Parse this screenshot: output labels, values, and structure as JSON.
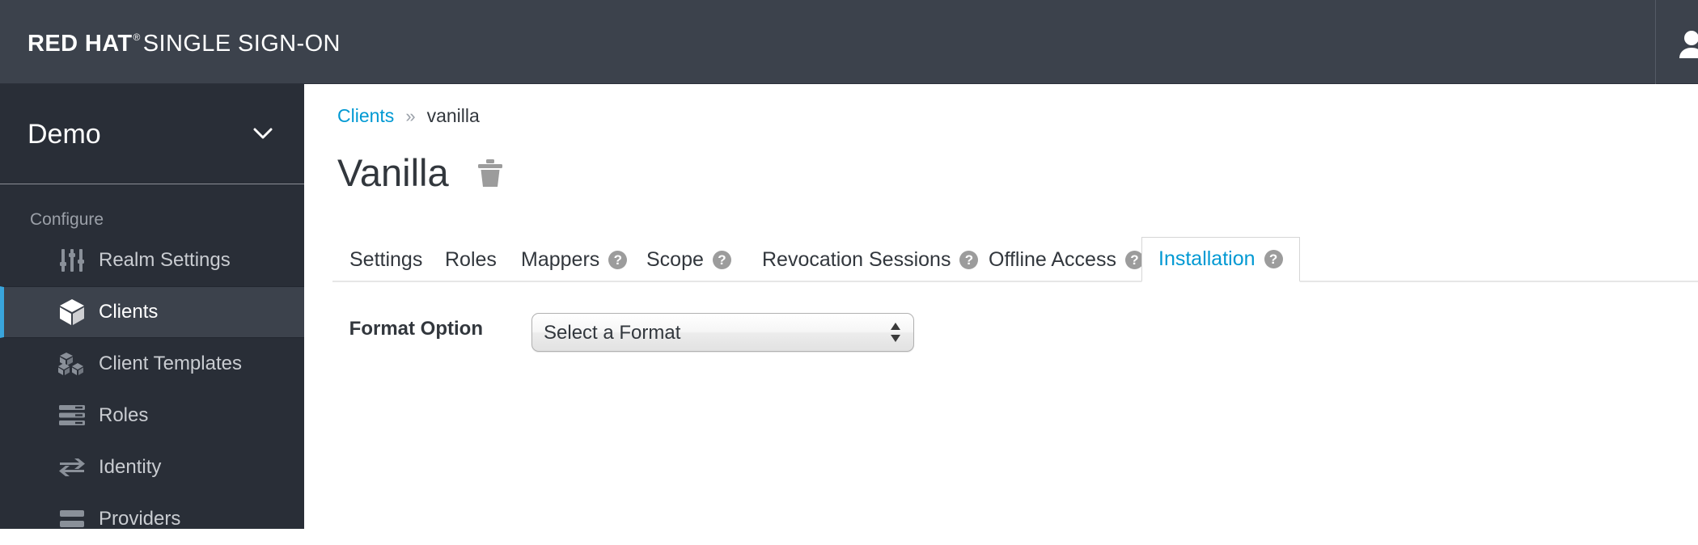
{
  "masthead": {
    "brand_bold": "RED HAT",
    "brand_reg": "®",
    "brand_rest": "SINGLE SIGN-ON",
    "user_icon": "user-icon",
    "bg_color": "#3c424c"
  },
  "sidebar": {
    "realm": {
      "name": "Demo",
      "chevron_icon": "chevron-down-icon"
    },
    "section_label": "Configure",
    "accent_color": "#39a5dc",
    "items": [
      {
        "label": "Realm Settings",
        "icon": "sliders-icon",
        "active": false
      },
      {
        "label": "Clients",
        "icon": "cube-icon",
        "active": true
      },
      {
        "label": "Client Templates",
        "icon": "cubes-icon",
        "active": false
      },
      {
        "label": "Roles",
        "icon": "server-list-icon",
        "active": false
      },
      {
        "label": "Identity",
        "icon": "exchange-arrows-icon",
        "active": false
      },
      {
        "label": "Providers",
        "icon": "providers-icon",
        "active": false
      }
    ]
  },
  "content": {
    "breadcrumb": {
      "parent": "Clients",
      "separator": "»",
      "current": "vanilla"
    },
    "page_title": "Vanilla",
    "delete_icon": "trash-icon",
    "tabs": [
      {
        "label": "Settings",
        "help": false,
        "active": false
      },
      {
        "label": "Roles",
        "help": false,
        "active": false
      },
      {
        "label": "Mappers",
        "help": true,
        "active": false
      },
      {
        "label": "Scope",
        "help": true,
        "active": false
      },
      {
        "label": "Revocation",
        "help": false,
        "active": false
      },
      {
        "label": "Sessions",
        "help": true,
        "active": false
      },
      {
        "label": "Offline Access",
        "help": true,
        "active": false
      },
      {
        "label": "Installation",
        "help": true,
        "active": true
      }
    ],
    "help_glyph": "?",
    "link_color": "#0099d3",
    "form": {
      "label": "Format Option",
      "select_value": "Select a Format",
      "select_options": [
        "Select a Format"
      ]
    }
  }
}
